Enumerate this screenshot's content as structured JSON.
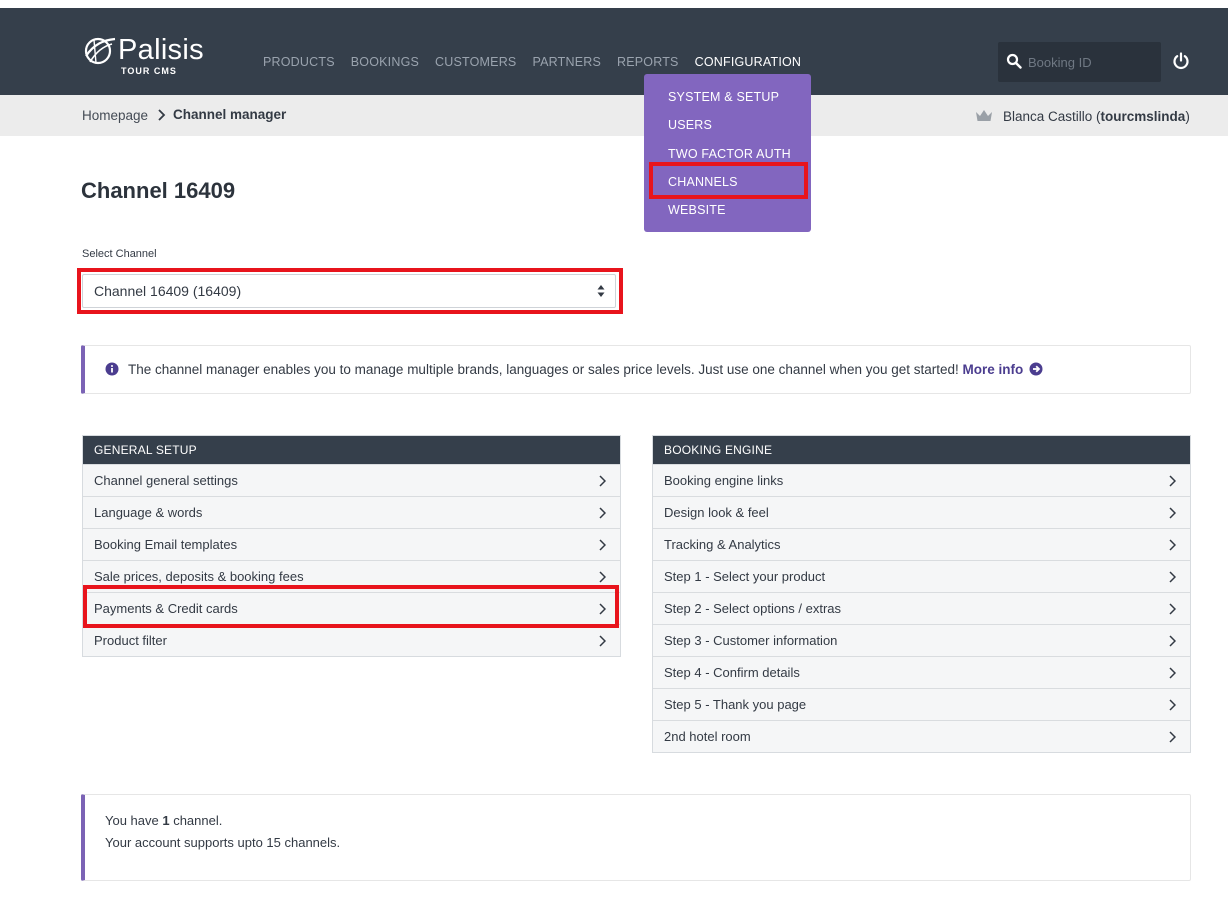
{
  "brand": {
    "name": "Palisis",
    "subtitle": "TOUR CMS",
    "logo_icon": "globe-swoosh-icon"
  },
  "nav": {
    "items": [
      {
        "label": "PRODUCTS"
      },
      {
        "label": "BOOKINGS"
      },
      {
        "label": "CUSTOMERS"
      },
      {
        "label": "PARTNERS"
      },
      {
        "label": "REPORTS"
      },
      {
        "label": "CONFIGURATION"
      }
    ],
    "active": "CONFIGURATION"
  },
  "search": {
    "placeholder": "Booking ID",
    "value": ""
  },
  "breadcrumb": {
    "home": "Homepage",
    "current": "Channel manager"
  },
  "user": {
    "name": "Blanca Castillo",
    "username": "tourcmslinda",
    "open_paren": " (",
    "close_paren": ")"
  },
  "config_menu": {
    "items": [
      {
        "label": "SYSTEM & SETUP"
      },
      {
        "label": "USERS"
      },
      {
        "label": "TWO FACTOR AUTH"
      },
      {
        "label": "CHANNELS"
      },
      {
        "label": "WEBSITE"
      }
    ],
    "highlighted": "CHANNELS"
  },
  "page": {
    "title": "Channel 16409",
    "select_label": "Select Channel",
    "select_value": "Channel 16409 (16409)"
  },
  "notice": {
    "text": "The channel manager enables you to manage multiple brands, languages or sales price levels. Just use one channel when you get started!",
    "link": "More info"
  },
  "general_setup": {
    "title": "GENERAL SETUP",
    "rows": [
      {
        "label": "Channel general settings"
      },
      {
        "label": "Language & words"
      },
      {
        "label": "Booking Email templates"
      },
      {
        "label": "Sale prices, deposits & booking fees"
      },
      {
        "label": "Payments & Credit cards"
      },
      {
        "label": "Product filter"
      }
    ],
    "highlighted": "Payments & Credit cards"
  },
  "booking_engine": {
    "title": "BOOKING ENGINE",
    "rows": [
      {
        "label": "Booking engine links"
      },
      {
        "label": "Design look & feel"
      },
      {
        "label": "Tracking & Analytics"
      },
      {
        "label": "Step 1 - Select your product"
      },
      {
        "label": "Step 2 - Select options / extras"
      },
      {
        "label": "Step 3 - Customer information"
      },
      {
        "label": "Step 4 - Confirm details"
      },
      {
        "label": "Step 5 - Thank you page"
      },
      {
        "label": "2nd hotel room"
      }
    ]
  },
  "footer_notice": {
    "line1_prefix": "You have ",
    "channel_count": "1",
    "line1_suffix": " channel.",
    "line2": "Your account supports upto 15 channels."
  },
  "colors": {
    "navbar": "#353f4b",
    "menu_purple": "#8266bf",
    "accent_purple": "#7b63b5",
    "highlight_red": "#e8141c"
  }
}
